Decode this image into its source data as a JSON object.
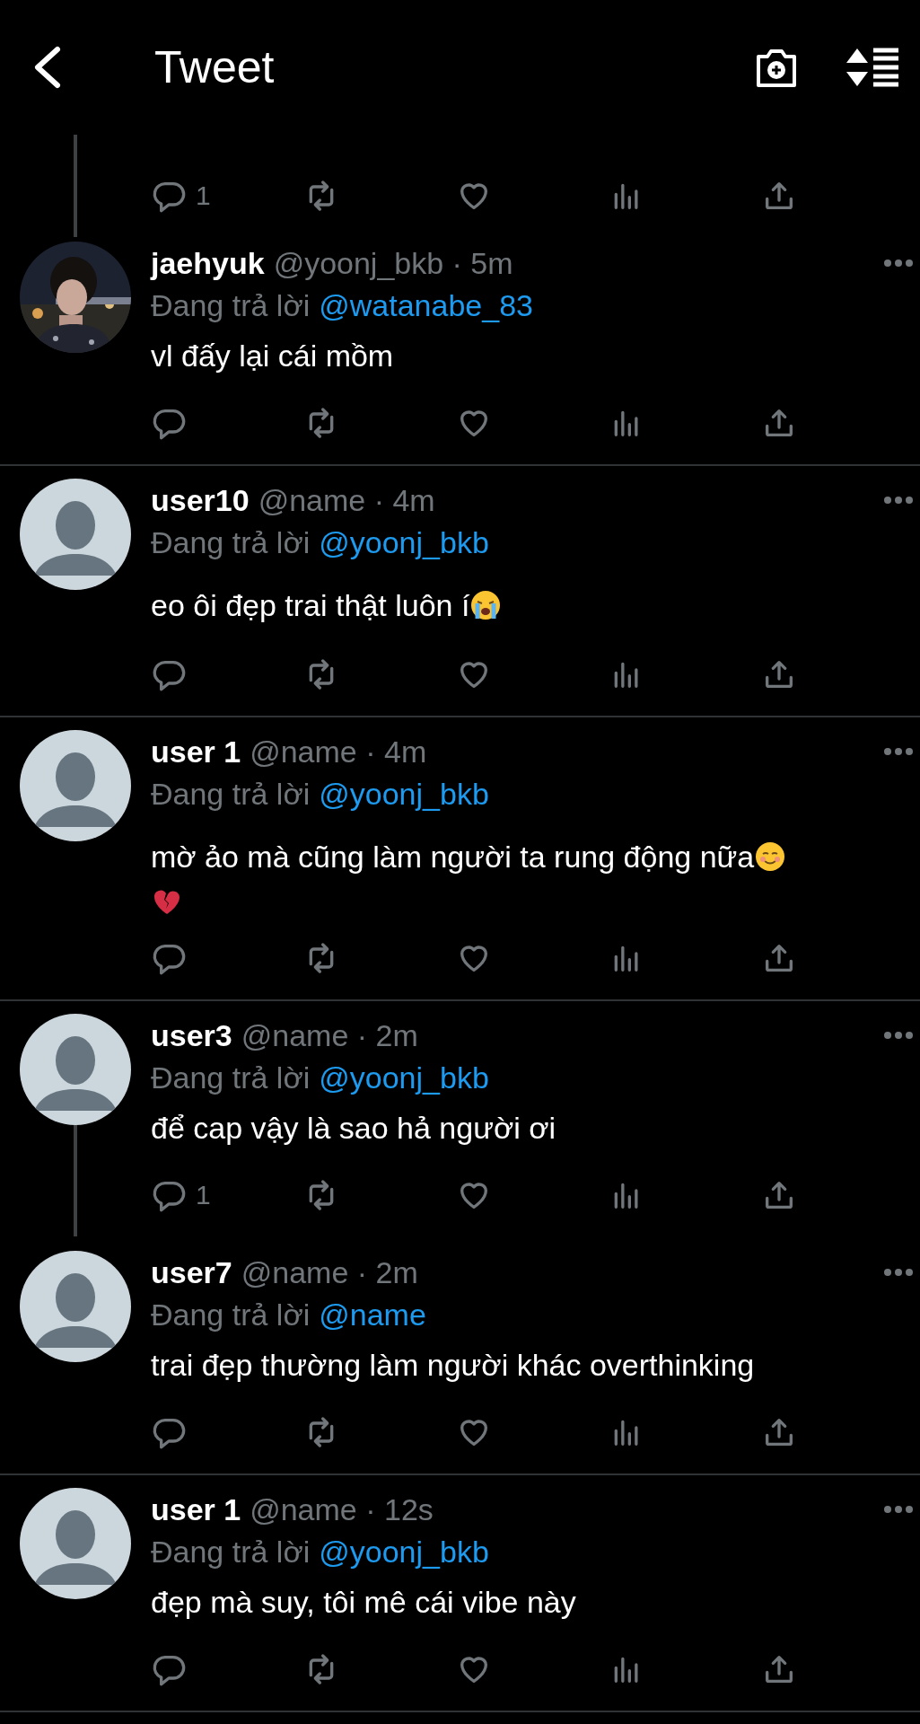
{
  "header": {
    "title": "Tweet"
  },
  "thread_top": {
    "reply_count": "1",
    "thread_below": true
  },
  "tweets": [
    {
      "name": "jaehyuk",
      "meta": "@yoonj_bkb · 5m",
      "reply_label": "Đang trả lời",
      "reply_to": "@watanabe_83",
      "has_photo": true,
      "body": [
        {
          "kind": "plain",
          "text": "vl đấy lại cái mồm"
        }
      ],
      "thread_below": false,
      "divider": true
    },
    {
      "name": "user10",
      "meta": "@name · 4m",
      "reply_label": "Đang trả lời",
      "reply_to": "@yoonj_bkb",
      "has_photo": false,
      "body": [
        {
          "kind": "crying",
          "text": "eo ôi đẹp trai thật luôn í"
        }
      ],
      "thread_below": false,
      "divider": true
    },
    {
      "name": "user 1",
      "meta": "@name · 4m",
      "reply_label": "Đang trả lời",
      "reply_to": "@yoonj_bkb",
      "has_photo": false,
      "body": [
        {
          "kind": "smiling",
          "text": "mờ ảo mà cũng làm người ta rung động nữa"
        },
        {
          "kind": "broken-heart"
        }
      ],
      "thread_below": false,
      "divider": true
    },
    {
      "name": "user3",
      "meta": "@name · 2m",
      "reply_label": "Đang trả lời",
      "reply_to": "@yoonj_bkb",
      "has_photo": false,
      "body": [
        {
          "kind": "plain",
          "text": "để cap vậy là sao hả người ơi"
        }
      ],
      "reply_count": "1",
      "thread_below": true,
      "divider": false
    },
    {
      "name": "user7",
      "meta": "@name · 2m",
      "reply_label": "Đang trả lời",
      "reply_to": "@name",
      "has_photo": false,
      "body": [
        {
          "kind": "plain",
          "text": "trai đẹp thường làm người khác overthinking"
        }
      ],
      "thread_below": false,
      "divider": true
    },
    {
      "name": "user 1",
      "meta": "@name · 12s",
      "reply_label": "Đang trả lời",
      "reply_to": "@yoonj_bkb",
      "has_photo": false,
      "body": [
        {
          "kind": "plain",
          "text": "đẹp mà suy, tôi mê cái vibe này"
        }
      ],
      "thread_below": false,
      "divider": true
    }
  ]
}
